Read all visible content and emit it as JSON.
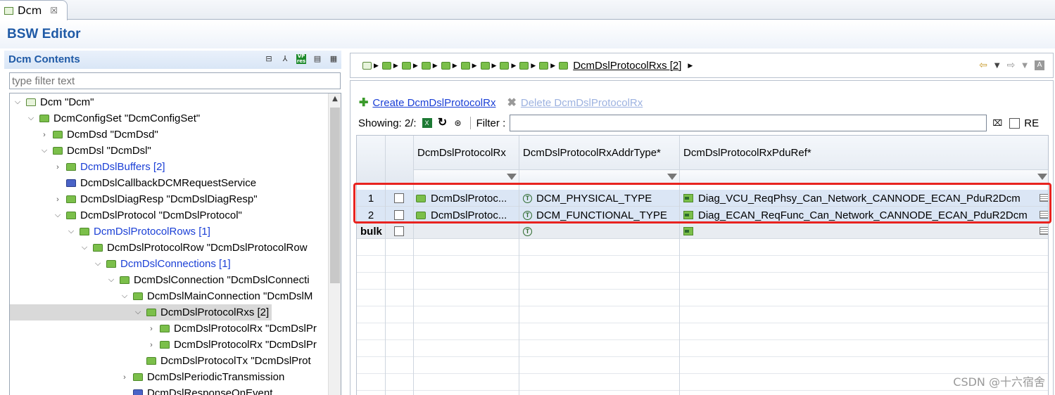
{
  "tab": {
    "title": "Dcm",
    "close": "☒"
  },
  "editor": {
    "title": "BSW Editor"
  },
  "left": {
    "title": "Dcm Contents",
    "filter_placeholder": "type filter text",
    "tree": [
      {
        "label": "Dcm \"Dcm\"",
        "level": 0,
        "twisty": "⌵",
        "icon": "sq",
        "link": false,
        "selected": false
      },
      {
        "label": "DcmConfigSet \"DcmConfigSet\"",
        "level": 1,
        "twisty": "⌵",
        "icon": "green",
        "link": false,
        "selected": false
      },
      {
        "label": "DcmDsd \"DcmDsd\"",
        "level": 2,
        "twisty": "›",
        "icon": "green",
        "link": false,
        "selected": false
      },
      {
        "label": "DcmDsl \"DcmDsl\"",
        "level": 2,
        "twisty": "⌵",
        "icon": "green",
        "link": false,
        "selected": false
      },
      {
        "label": "DcmDslBuffers [2]",
        "level": 3,
        "twisty": "›",
        "icon": "green",
        "link": true,
        "selected": false
      },
      {
        "label": "DcmDslCallbackDCMRequestService",
        "level": 3,
        "twisty": "",
        "icon": "blue",
        "link": false,
        "selected": false
      },
      {
        "label": "DcmDslDiagResp \"DcmDslDiagResp\"",
        "level": 3,
        "twisty": "›",
        "icon": "green",
        "link": false,
        "selected": false
      },
      {
        "label": "DcmDslProtocol \"DcmDslProtocol\"",
        "level": 3,
        "twisty": "⌵",
        "icon": "green",
        "link": false,
        "selected": false
      },
      {
        "label": "DcmDslProtocolRows [1]",
        "level": 4,
        "twisty": "⌵",
        "icon": "green",
        "link": true,
        "selected": false
      },
      {
        "label": "DcmDslProtocolRow \"DcmDslProtocolRow",
        "level": 5,
        "twisty": "⌵",
        "icon": "green",
        "link": false,
        "selected": false
      },
      {
        "label": "DcmDslConnections [1]",
        "level": 6,
        "twisty": "⌵",
        "icon": "green",
        "link": true,
        "selected": false
      },
      {
        "label": "DcmDslConnection \"DcmDslConnecti",
        "level": 7,
        "twisty": "⌵",
        "icon": "green",
        "link": false,
        "selected": false
      },
      {
        "label": "DcmDslMainConnection \"DcmDslM",
        "level": 8,
        "twisty": "⌵",
        "icon": "green",
        "link": false,
        "selected": false
      },
      {
        "label": "DcmDslProtocolRxs [2]",
        "level": 9,
        "twisty": "⌵",
        "icon": "green",
        "link": false,
        "selected": true
      },
      {
        "label": "DcmDslProtocolRx \"DcmDslPr",
        "level": 10,
        "twisty": "›",
        "icon": "green",
        "link": false,
        "selected": false
      },
      {
        "label": "DcmDslProtocolRx \"DcmDslPr",
        "level": 10,
        "twisty": "›",
        "icon": "green",
        "link": false,
        "selected": false
      },
      {
        "label": "DcmDslProtocolTx \"DcmDslProt",
        "level": 9,
        "twisty": "",
        "icon": "green",
        "link": false,
        "selected": false
      },
      {
        "label": "DcmDslPeriodicTransmission",
        "level": 8,
        "twisty": "›",
        "icon": "green",
        "link": false,
        "selected": false
      },
      {
        "label": "DcmDslResponseOnEvent",
        "level": 8,
        "twisty": "",
        "icon": "blue",
        "link": false,
        "selected": false
      }
    ]
  },
  "breadcrumb": {
    "current": "DcmDslProtocolRxs [2]"
  },
  "actions": {
    "create_label": "Create DcmDslProtocolRx",
    "delete_label": "Delete DcmDslProtocolRx"
  },
  "toolbar": {
    "showing": "Showing: 2/:",
    "filter_label": "Filter :",
    "filter_value": "",
    "re_label": "RE"
  },
  "table": {
    "columns": [
      "DcmDslProtocolRx",
      "DcmDslProtocolRxAddrType*",
      "DcmDslProtocolRxPduRef*"
    ],
    "rows": [
      {
        "num": "1",
        "name": "DcmDslProtoc...",
        "addr_type": "DCM_PHYSICAL_TYPE",
        "pdu_ref": "Diag_VCU_ReqPhsy_Can_Network_CANNODE_ECAN_PduR2Dcm"
      },
      {
        "num": "2",
        "name": "DcmDslProtoc...",
        "addr_type": "DCM_FUNCTIONAL_TYPE",
        "pdu_ref": "Diag_ECAN_ReqFunc_Can_Network_CANNODE_ECAN_PduR2Dcm"
      }
    ],
    "bulk_label": "bulk"
  },
  "watermark": "CSDN @十六宿舍",
  "colors": {
    "accent": "#1f5aa6",
    "link": "#1a3fd6",
    "highlight": "#e8231f"
  }
}
